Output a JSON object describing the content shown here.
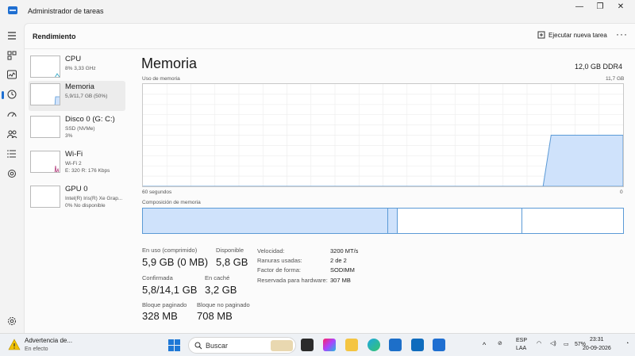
{
  "window": {
    "title": "Administrador de tareas"
  },
  "header": {
    "page_title": "Rendimiento",
    "new_task": "Ejecutar nueva tarea",
    "more": "···"
  },
  "sidebar": {
    "items": [
      {
        "name": "CPU",
        "sub1": "8% 3,33 GHz",
        "sub2": "",
        "sub3": ""
      },
      {
        "name": "Memoria",
        "sub1": "5,9/11,7 GB (50%)",
        "sub2": "",
        "sub3": ""
      },
      {
        "name": "Disco 0 (G: C:)",
        "sub1": "SSD (NVMe)",
        "sub2": "3%",
        "sub3": ""
      },
      {
        "name": "Wi-Fi",
        "sub1": "Wi-Fi 2",
        "sub2": "E: 320 R: 176 Kbps",
        "sub3": ""
      },
      {
        "name": "GPU 0",
        "sub1": "Intel(R) Iris(R) Xe Grap...",
        "sub2": "0% No disponible",
        "sub3": ""
      }
    ]
  },
  "memory": {
    "title": "Memoria",
    "spec": "12,0 GB DDR4",
    "usage_label": "Uso de memoria",
    "usage_max": "11,7 GB",
    "time_left": "60 segundos",
    "time_right": "0",
    "composition_label": "Composición de memoria",
    "usage_graph": {
      "x_seconds": [
        60,
        10,
        9,
        0
      ],
      "y_fraction": [
        0,
        0,
        0.5,
        0.5
      ]
    },
    "composition": {
      "in_use": 0.51,
      "modified": 0.02,
      "standby": 0.26,
      "free": 0.21
    },
    "stats": {
      "in_use_label": "En uso (comprimido)",
      "in_use_value": "5,9 GB (0 MB)",
      "available_label": "Disponible",
      "available_value": "5,8 GB",
      "committed_label": "Confirmada",
      "committed_value": "5,8/14,1 GB",
      "cached_label": "En caché",
      "cached_value": "3,2 GB",
      "paged_label": "Bloque paginado",
      "paged_value": "328 MB",
      "nonpaged_label": "Bloque no paginado",
      "nonpaged_value": "708 MB"
    },
    "details": {
      "speed_label": "Velocidad:",
      "speed_value": "3200 MT/s",
      "slots_label": "Ranuras usadas:",
      "slots_value": "2 de 2",
      "form_label": "Factor de forma:",
      "form_value": "SODIMM",
      "reserved_label": "Reservada para hardware:",
      "reserved_value": "307 MB"
    }
  },
  "taskbar": {
    "notice_title": "Advertencia de...",
    "notice_sub": "En efecto",
    "search_placeholder": "Buscar",
    "lang_line1": "ESP",
    "lang_line2": "LAA",
    "battery": "57%",
    "time": "23:31",
    "date": "20-09-2026"
  },
  "colors": {
    "accent": "#1f6fd1",
    "mem_fill": "#cfe2fb",
    "mem_line": "#5b9ad6"
  }
}
